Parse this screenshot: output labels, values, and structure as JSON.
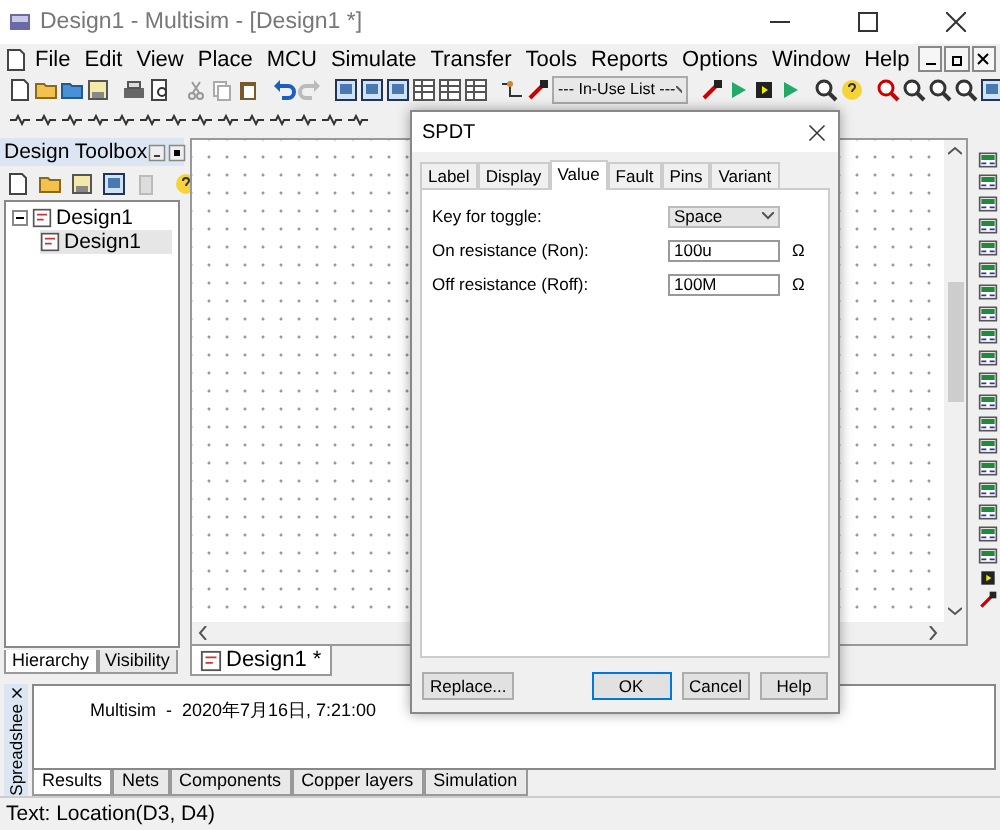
{
  "window": {
    "title": "Design1 - Multisim - [Design1 *]"
  },
  "menu": [
    "File",
    "Edit",
    "View",
    "Place",
    "MCU",
    "Simulate",
    "Transfer",
    "Tools",
    "Reports",
    "Options",
    "Window",
    "Help"
  ],
  "toolbar": {
    "in_use_list": "--- In-Use List ---"
  },
  "design_toolbox": {
    "title": "Design Toolbox",
    "tree": [
      {
        "label": "Design1",
        "expanded": true,
        "children": [
          {
            "label": "Design1",
            "selected": true
          }
        ]
      }
    ],
    "tabs": [
      {
        "label": "Hierarchy",
        "selected": true
      },
      {
        "label": "Visibility",
        "selected": false
      }
    ]
  },
  "canvas": {
    "tabs": [
      {
        "label": "Design1 *",
        "selected": true
      }
    ]
  },
  "dialog": {
    "title": "SPDT",
    "tabs": [
      {
        "label": "Label",
        "selected": false
      },
      {
        "label": "Display",
        "selected": false
      },
      {
        "label": "Value",
        "selected": true
      },
      {
        "label": "Fault",
        "selected": false
      },
      {
        "label": "Pins",
        "selected": false
      },
      {
        "label": "Variant",
        "selected": false
      }
    ],
    "fields": [
      {
        "kind": "dropdown",
        "label": "Key for toggle:",
        "value": "Space"
      },
      {
        "kind": "text",
        "label": "On resistance (Ron):",
        "value": "100u",
        "unit": "Ω"
      },
      {
        "kind": "text",
        "label": "Off resistance (Roff):",
        "value": "100M",
        "unit": "Ω"
      }
    ],
    "buttons": [
      {
        "label": "Replace...",
        "default": false
      },
      {
        "label": "OK",
        "default": true
      },
      {
        "label": "Cancel",
        "default": false
      },
      {
        "label": "Help",
        "default": false
      }
    ]
  },
  "spreadsheet": {
    "title": "Spreadshee",
    "log": "Multisim  -  2020年7月16日, 7:21:00",
    "tabs": [
      {
        "label": "Results",
        "selected": true
      },
      {
        "label": "Nets",
        "selected": false
      },
      {
        "label": "Components",
        "selected": false
      },
      {
        "label": "Copper layers",
        "selected": false
      },
      {
        "label": "Simulation",
        "selected": false
      }
    ]
  },
  "status_bar": {
    "text": "Text: Location(D3, D4)"
  }
}
